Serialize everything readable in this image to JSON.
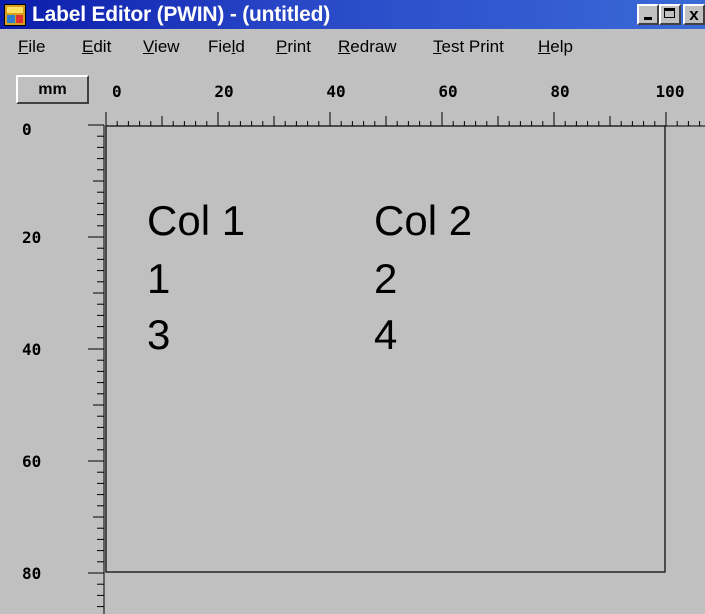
{
  "window": {
    "title": "Label Editor (PWIN) - (untitled)",
    "title_bar_color": "#0a1cab",
    "background_color": "#c0c0c0"
  },
  "title_buttons": {
    "minimize_icon": "minimize-icon",
    "maximize_icon": "maximize-icon",
    "close_label": "x"
  },
  "menu": {
    "items": [
      {
        "label": "File",
        "mnemonic": "F"
      },
      {
        "label": "Edit",
        "mnemonic": "E"
      },
      {
        "label": "View",
        "mnemonic": "V"
      },
      {
        "label": "Field",
        "mnemonic": "l"
      },
      {
        "label": "Print",
        "mnemonic": "P"
      },
      {
        "label": "Redraw",
        "mnemonic": "R"
      },
      {
        "label": "Test Print",
        "mnemonic": "T"
      },
      {
        "label": "Help",
        "mnemonic": "H"
      }
    ]
  },
  "units_button": {
    "label": "mm"
  },
  "ruler": {
    "horizontal_ticks": [
      "0",
      "20",
      "40",
      "60",
      "80",
      "100"
    ],
    "vertical_ticks": [
      "0",
      "20",
      "40",
      "60",
      "80"
    ],
    "unit": "mm"
  },
  "label": {
    "fields": [
      {
        "text": "Col 1"
      },
      {
        "text": "Col 2"
      },
      {
        "text": "1"
      },
      {
        "text": "2"
      },
      {
        "text": "3"
      },
      {
        "text": "4"
      }
    ]
  }
}
